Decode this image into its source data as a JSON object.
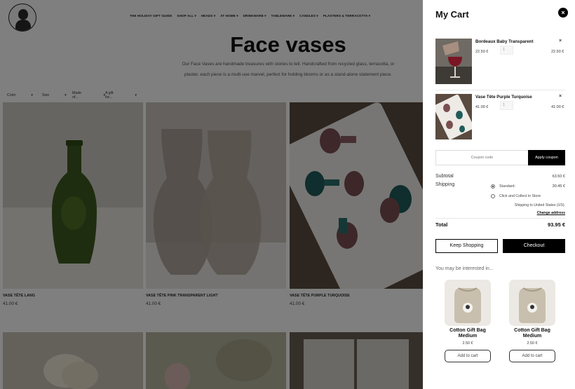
{
  "nav": {
    "items": [
      "THE HOLIDAY GIFT GUIDE",
      "SHOP ALL",
      "HEADS",
      "AT HOME",
      "DRINKWARE",
      "TABLEWARE",
      "CANDLES",
      "PLASTERS & TERRACOTTA"
    ]
  },
  "page": {
    "title": "Face vases",
    "description": "Our Face Vases are handmade treasures with stories to tell. Handcrafted from recycled glass, terracotta, or plaster, each piece is a multi-use marvel, perfect for holding blooms or as a stand-alone statement piece.",
    "filters": [
      "Color",
      "Size",
      "Made of...",
      "A gift for..."
    ]
  },
  "products": [
    {
      "name": "VASE TÊTE LANG",
      "price": "41.00 €"
    },
    {
      "name": "VASE TÊTE PINK TRANSPARENT LIGHT",
      "price": "41.00 €"
    },
    {
      "name": "VASE TÊTE PURPLE TURQUOISE",
      "price": "41.00 €"
    }
  ],
  "cart": {
    "title": "My Cart",
    "close_symbol": "×",
    "items": [
      {
        "name": "Bordeaux Baby Transparent",
        "price": "22.50 €",
        "qty": "1",
        "total": "22.50 €",
        "remove": "×"
      },
      {
        "name": "Vase Tête Purple Turquoise",
        "price": "41.00 €",
        "qty": "1",
        "total": "41.00 €",
        "remove": "×"
      }
    ],
    "coupon_placeholder": "Coupon code",
    "apply_coupon": "Apply coupon",
    "subtotal_label": "Subtotal",
    "subtotal_value": "63.50 €",
    "shipping_label": "Shipping",
    "shipping_options": [
      {
        "label": "Standard:",
        "value": "30.45 €",
        "selected": true
      },
      {
        "label": "Click and Collect in Store",
        "value": "",
        "selected": false
      }
    ],
    "shipping_to": "Shipping to United States (US).",
    "change_address": "Change address",
    "total_label": "Total",
    "total_value": "93.95 €",
    "keep_shopping": "Keep Shopping",
    "checkout": "Checkout",
    "interested_title": "You may be interested in...",
    "recommendations": [
      {
        "name": "Cotton Gift Bag Medium",
        "price": "2.50 €",
        "button": "Add to cart"
      },
      {
        "name": "Cotton Gift Bag Medium",
        "price": "2.50 €",
        "button": "Add to cart"
      }
    ]
  },
  "colors": {
    "accent": "#000000",
    "overlay": "rgba(0,0,0,0.5)",
    "background": "#ffffff"
  }
}
